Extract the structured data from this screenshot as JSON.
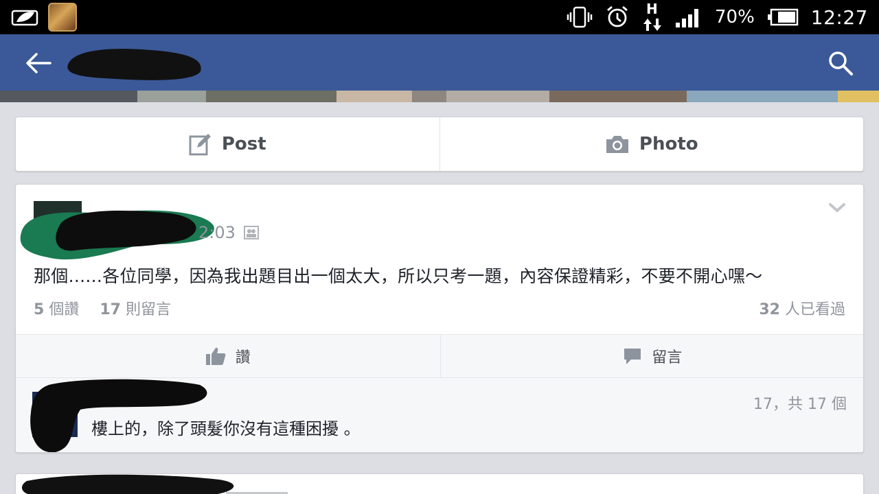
{
  "status_bar": {
    "battery_percent": "70%",
    "time": "12:27",
    "network_type": "H"
  },
  "app_bar": {
    "back_icon": "arrow-left-icon",
    "search_icon": "search-icon"
  },
  "composer": {
    "post_label": "Post",
    "photo_label": "Photo"
  },
  "post": {
    "time": "2:03",
    "text": "那個......各位同學，因為我出題目出一個太大，所以只考一題，內容保證精彩，不要不開心嘿～",
    "likes_count": "5",
    "likes_label": "個讚",
    "comments_count": "17",
    "comments_label": "則留言",
    "seen_count": "32",
    "seen_label": "人已看過",
    "like_action": "讚",
    "comment_action": "留言"
  },
  "comment": {
    "index": "17，共 17 個",
    "text": "樓上的，除了頭髮你沒有這種困擾 。"
  },
  "colors": {
    "facebook_blue": "#3b5998",
    "background": "#dcdee3",
    "text_primary": "#1d2129",
    "text_secondary": "#90949c"
  }
}
